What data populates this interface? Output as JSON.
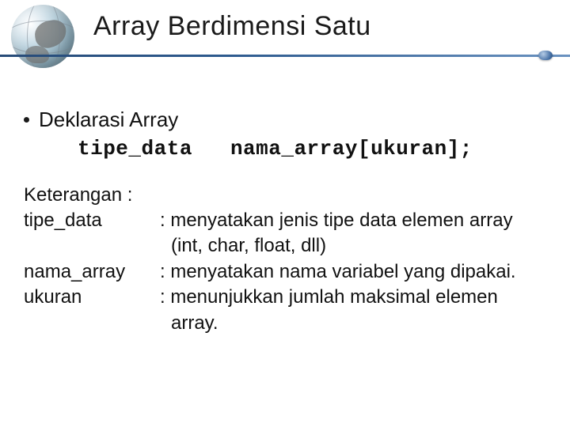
{
  "title": "Array Berdimensi Satu",
  "bullet": "Deklarasi Array",
  "code": {
    "part1": "tipe_data",
    "part2": "nama_array[ukuran];"
  },
  "keterangan_label": "Keterangan :",
  "defs": [
    {
      "term": "tipe_data",
      "desc": ": menyatakan jenis tipe data elemen array",
      "cont": "(int, char, float, dll)"
    },
    {
      "term": "nama_array",
      "desc": ": menyatakan nama variabel yang dipakai."
    },
    {
      "term": "ukuran",
      "desc": ": menunjukkan jumlah maksimal elemen",
      "cont": "array."
    }
  ]
}
